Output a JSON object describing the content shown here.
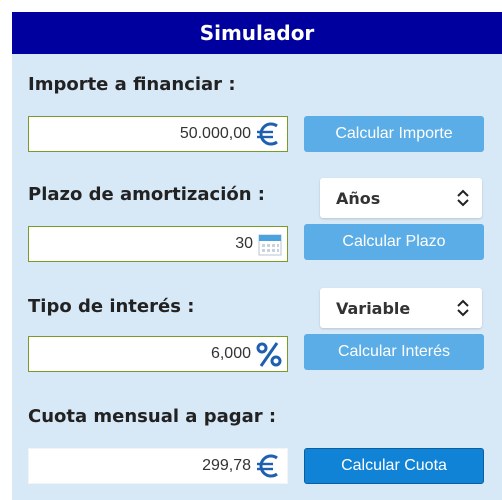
{
  "header": {
    "title": "Simulador"
  },
  "importe": {
    "label": "Importe a financiar :",
    "value": "50.000,00",
    "button": "Calcular Importe"
  },
  "plazo": {
    "label": "Plazo de amortización :",
    "select": "Años",
    "value": "30",
    "button": "Calcular Plazo"
  },
  "interes": {
    "label": "Tipo de interés :",
    "select": "Variable",
    "value": "6,000",
    "button": "Calcular Interés"
  },
  "cuota": {
    "label": "Cuota mensual a pagar :",
    "value": "299,78",
    "button": "Calcular Cuota"
  },
  "icons": {
    "euro": "euro-icon",
    "calendar": "calendar-icon",
    "percent": "percent-icon",
    "select_arrows": "chevron-updown-icon"
  },
  "colors": {
    "header": "#00009f",
    "panel": "#d7e8f7",
    "button": "#5aade6",
    "button_active": "#1183d6",
    "euro": "#1f5fb0"
  }
}
